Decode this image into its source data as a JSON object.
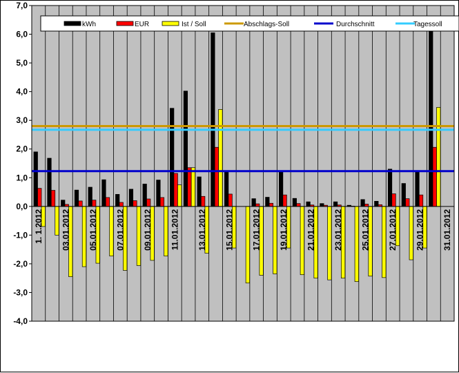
{
  "chart_data": {
    "type": "bar",
    "title": "",
    "xlabel": "",
    "ylabel": "",
    "ylim": [
      -4,
      7
    ],
    "yticks": [
      "7,0",
      "6,0",
      "5,0",
      "4,0",
      "3,0",
      "2,0",
      "1,0",
      "0,0",
      "-1,0",
      "-2,0",
      "-3,0",
      "-4,0"
    ],
    "ytick_values": [
      7,
      6,
      5,
      4,
      3,
      2,
      1,
      0,
      -1,
      -2,
      -3,
      -4
    ],
    "categories": [
      "01",
      "02",
      "03",
      "04",
      "05",
      "06",
      "07",
      "08",
      "09",
      "10",
      "11",
      "12",
      "13",
      "14",
      "15",
      "16",
      "17",
      "18",
      "19",
      "20",
      "21",
      "22",
      "23",
      "24",
      "25",
      "26",
      "27",
      "28",
      "29",
      "30",
      "31"
    ],
    "x_tick_labels": [
      {
        "day": 1,
        "text": "1. 1.2012"
      },
      {
        "day": 3,
        "text": "03.01.2012"
      },
      {
        "day": 5,
        "text": "05.01.2012"
      },
      {
        "day": 7,
        "text": "07.01.2012"
      },
      {
        "day": 9,
        "text": "09.01.2012"
      },
      {
        "day": 11,
        "text": "11.01.2012"
      },
      {
        "day": 13,
        "text": "13.01.2012"
      },
      {
        "day": 15,
        "text": "15.01.2012"
      },
      {
        "day": 17,
        "text": "17.01.2012"
      },
      {
        "day": 19,
        "text": "19.01.2012"
      },
      {
        "day": 21,
        "text": "21.01.2012"
      },
      {
        "day": 23,
        "text": "23.01.2012"
      },
      {
        "day": 25,
        "text": "25.01.2012"
      },
      {
        "day": 27,
        "text": "27.01.2012"
      },
      {
        "day": 29,
        "text": "29.01.2012"
      },
      {
        "day": 31,
        "text": "31.01.2012"
      }
    ],
    "series": [
      {
        "name": "kWh",
        "kind": "bar",
        "color": "#000000",
        "values": [
          1.9,
          1.68,
          0.22,
          0.57,
          0.67,
          0.93,
          0.42,
          0.6,
          0.78,
          0.92,
          3.42,
          4.02,
          1.03,
          6.05,
          1.2,
          0.0,
          0.27,
          0.32,
          1.2,
          0.28,
          0.16,
          0.1,
          0.16,
          0.04,
          0.24,
          0.18,
          1.3,
          0.8,
          1.2,
          6.1,
          0.0
        ]
      },
      {
        "name": "EUR",
        "kind": "bar",
        "color": "#ff0000",
        "values": [
          0.63,
          0.56,
          0.07,
          0.19,
          0.22,
          0.31,
          0.14,
          0.2,
          0.26,
          0.31,
          1.15,
          1.35,
          0.35,
          2.06,
          0.43,
          0.0,
          0.09,
          0.11,
          0.4,
          0.1,
          0.05,
          0.04,
          0.05,
          0.01,
          0.08,
          0.06,
          0.44,
          0.27,
          0.4,
          2.06,
          0.0
        ]
      },
      {
        "name": "Ist / Soll",
        "kind": "bar",
        "color": "#ffff00",
        "values": [
          -0.7,
          -1.0,
          -2.45,
          -2.1,
          -1.98,
          -1.73,
          -2.23,
          -2.06,
          -1.88,
          -1.73,
          0.75,
          1.35,
          -1.63,
          3.38,
          -1.45,
          -2.67,
          -2.4,
          -2.35,
          -1.45,
          -2.38,
          -2.5,
          -2.56,
          -2.5,
          -2.62,
          -2.43,
          -2.48,
          -1.37,
          -1.86,
          -1.45,
          3.45,
          0.0
        ]
      },
      {
        "name": "Abschlags-Soll",
        "kind": "line",
        "color": "#cc9900",
        "value": 2.8
      },
      {
        "name": "Durchschnitt",
        "kind": "line",
        "color": "#0000cc",
        "value": 1.23
      },
      {
        "name": "Tagessoll",
        "kind": "line",
        "color": "#33ccff",
        "value": 2.67
      }
    ],
    "grid": "vertical",
    "legend_position": "top",
    "plot_background": "#c0c0c0"
  }
}
